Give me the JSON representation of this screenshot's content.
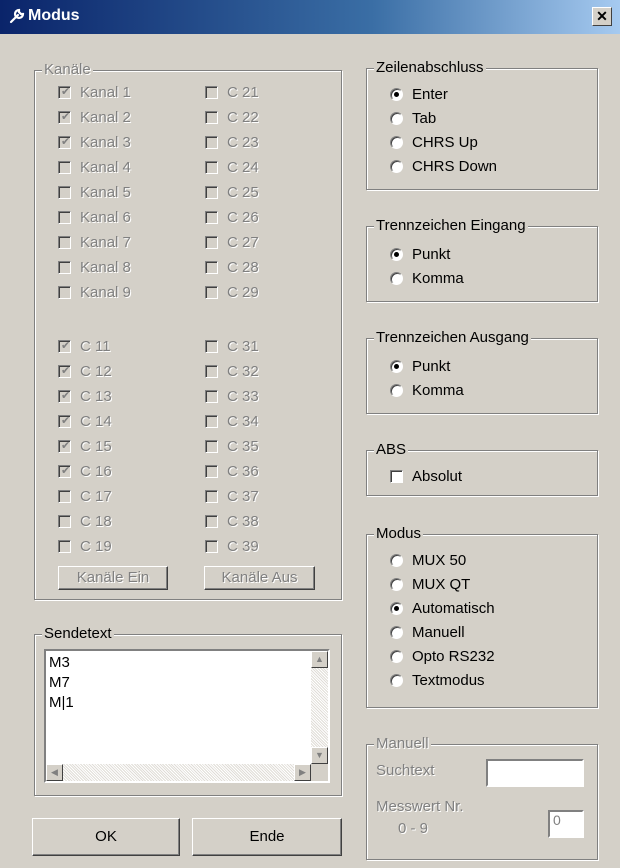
{
  "window": {
    "title": "Modus",
    "close_glyph": "✕",
    "title_icon": "wrench-icon"
  },
  "kanaele": {
    "legend": "Kanäle",
    "col1": [
      {
        "label": "Kanal 1",
        "checked": true
      },
      {
        "label": "Kanal 2",
        "checked": true
      },
      {
        "label": "Kanal 3",
        "checked": true
      },
      {
        "label": "Kanal 4",
        "checked": false
      },
      {
        "label": "Kanal 5",
        "checked": false
      },
      {
        "label": "Kanal 6",
        "checked": false
      },
      {
        "label": "Kanal 7",
        "checked": false
      },
      {
        "label": "Kanal 8",
        "checked": false
      },
      {
        "label": "Kanal 9",
        "checked": false
      }
    ],
    "col2": [
      {
        "label": "C 21",
        "checked": false
      },
      {
        "label": "C 22",
        "checked": false
      },
      {
        "label": "C 23",
        "checked": false
      },
      {
        "label": "C 24",
        "checked": false
      },
      {
        "label": "C 25",
        "checked": false
      },
      {
        "label": "C 26",
        "checked": false
      },
      {
        "label": "C 27",
        "checked": false
      },
      {
        "label": "C 28",
        "checked": false
      },
      {
        "label": "C 29",
        "checked": false
      }
    ],
    "col3": [
      {
        "label": "C 11",
        "checked": true
      },
      {
        "label": "C 12",
        "checked": true
      },
      {
        "label": "C 13",
        "checked": true
      },
      {
        "label": "C 14",
        "checked": true
      },
      {
        "label": "C 15",
        "checked": true
      },
      {
        "label": "C 16",
        "checked": true
      },
      {
        "label": "C 17",
        "checked": false
      },
      {
        "label": "C 18",
        "checked": false
      },
      {
        "label": "C 19",
        "checked": false
      }
    ],
    "col4": [
      {
        "label": "C 31",
        "checked": false
      },
      {
        "label": "C 32",
        "checked": false
      },
      {
        "label": "C 33",
        "checked": false
      },
      {
        "label": "C 34",
        "checked": false
      },
      {
        "label": "C 35",
        "checked": false
      },
      {
        "label": "C 36",
        "checked": false
      },
      {
        "label": "C 37",
        "checked": false
      },
      {
        "label": "C 38",
        "checked": false
      },
      {
        "label": "C 39",
        "checked": false
      }
    ],
    "btn_ein": "Kanäle Ein",
    "btn_aus": "Kanäle Aus"
  },
  "sendetext": {
    "legend": "Sendetext",
    "lines": [
      "M3",
      "M7",
      "M|1"
    ]
  },
  "buttons": {
    "ok": "OK",
    "ende": "Ende"
  },
  "zeilenabschluss": {
    "legend": "Zeilenabschluss",
    "options": [
      {
        "label": "Enter",
        "selected": true
      },
      {
        "label": "Tab",
        "selected": false
      },
      {
        "label": "CHRS Up",
        "selected": false
      },
      {
        "label": "CHRS Down",
        "selected": false
      }
    ]
  },
  "trenn_eingang": {
    "legend": "Trennzeichen Eingang",
    "options": [
      {
        "label": "Punkt",
        "selected": true
      },
      {
        "label": "Komma",
        "selected": false
      }
    ]
  },
  "trenn_ausgang": {
    "legend": "Trennzeichen Ausgang",
    "options": [
      {
        "label": "Punkt",
        "selected": true
      },
      {
        "label": "Komma",
        "selected": false
      }
    ]
  },
  "abs": {
    "legend": "ABS",
    "label": "Absolut",
    "checked": false
  },
  "modus": {
    "legend": "Modus",
    "options": [
      {
        "label": "MUX 50",
        "selected": false
      },
      {
        "label": "MUX QT",
        "selected": false
      },
      {
        "label": "Automatisch",
        "selected": true
      },
      {
        "label": "Manuell",
        "selected": false
      },
      {
        "label": "Opto RS232",
        "selected": false
      },
      {
        "label": "Textmodus",
        "selected": false
      }
    ]
  },
  "manuell": {
    "legend": "Manuell",
    "suchtext_label": "Suchtext",
    "suchtext_value": "",
    "messwert_label": "Messwert Nr.",
    "range_label": "0 - 9",
    "messwert_value": "0"
  }
}
